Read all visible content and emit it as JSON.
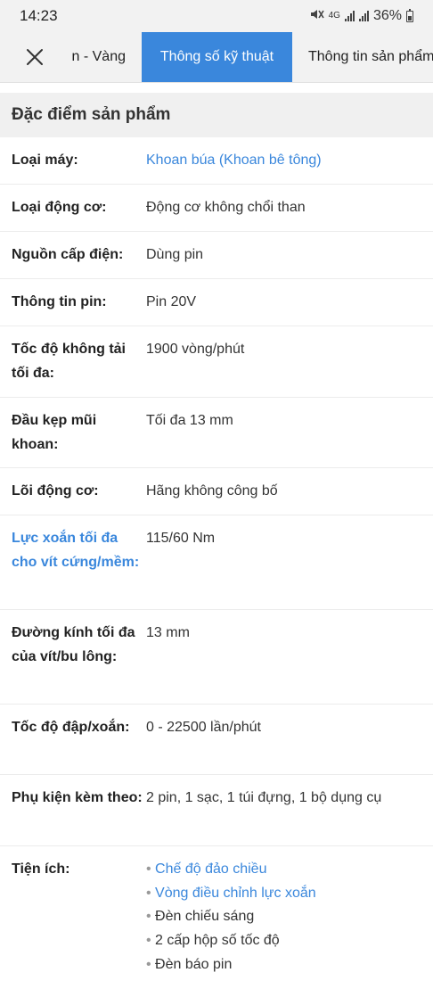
{
  "status": {
    "time": "14:23",
    "network": "4G",
    "battery": "36%"
  },
  "tabs": [
    {
      "label": "n - Vàng",
      "active": false
    },
    {
      "label": "Thông số kỹ thuật",
      "active": true
    },
    {
      "label": "Thông tin sản phẩm",
      "active": false
    }
  ],
  "icons": {
    "close": "close-icon",
    "mute": "mute-icon",
    "signal": "signal-icon",
    "battery": "battery-icon"
  },
  "colors": {
    "accent": "#3a87dc",
    "section_bg": "#f0f0f0",
    "statusbar_bg": "#f2f2f2"
  },
  "section": {
    "title": "Đặc điểm sản phẩm"
  },
  "specs": [
    {
      "label": "Loại máy:",
      "value": "Khoan búa (Khoan bê tông)"
    },
    {
      "label": "Loại động cơ:",
      "value": "Động cơ không chổi than"
    },
    {
      "label": "Nguồn cấp điện:",
      "value": "Dùng pin"
    },
    {
      "label": "Thông tin pin:",
      "value": "Pin 20V"
    },
    {
      "label": "Tốc độ không tải tối đa:",
      "value": "1900 vòng/phút"
    },
    {
      "label": "Đầu kẹp mũi khoan:",
      "value": "Tối đa 13 mm"
    },
    {
      "label": "Lõi động cơ:",
      "value": "Hãng không công bố"
    },
    {
      "label": "Lực xoắn tối đa cho vít cứng/mềm:",
      "value": "115/60 Nm"
    },
    {
      "label": "Đường kính tối đa của vít/bu lông:",
      "value": "13 mm"
    },
    {
      "label": "Tốc độ đập/xoắn:",
      "value": "0 - 22500 lần/phút"
    },
    {
      "label": "Phụ kiện kèm theo:",
      "value": "2 pin, 1 sạc, 1 túi đựng, 1 bộ dụng cụ"
    },
    {
      "label": "Tiện ích:",
      "bullets": [
        "Chế độ đảo chiều",
        "Vòng điều chỉnh lực xoắn",
        "Đèn chiếu sáng",
        "2 cấp hộp số tốc độ",
        "Đèn báo pin"
      ]
    }
  ]
}
